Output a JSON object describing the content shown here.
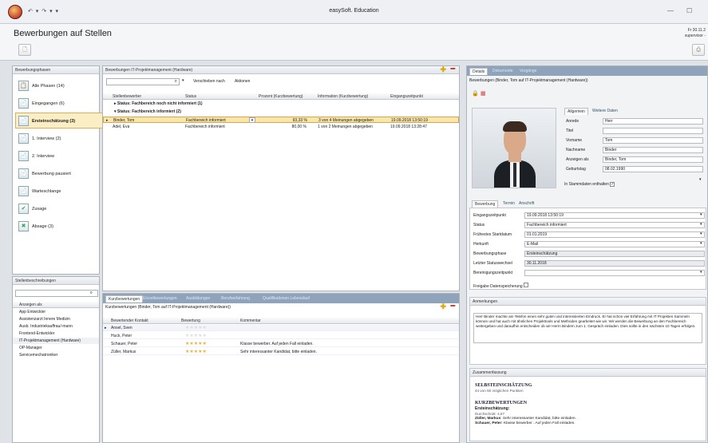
{
  "window": {
    "title": "easySoft. Education",
    "qat": "↶ ▾ ↷ ▾ ▾",
    "minimize": "—",
    "maximize": "☐"
  },
  "header": {
    "title": "Bewerbungen auf Stellen",
    "date": "Fr 30.11.2",
    "user": "supervisor -"
  },
  "phases": {
    "title": "Bewerbungsphasen",
    "items": [
      {
        "label": "Alle Phasen (14)",
        "icon": "📋"
      },
      {
        "label": "Eingegangen (6)",
        "icon": "📄"
      },
      {
        "label": "Ersteinschätzung (3)",
        "icon": "📄"
      },
      {
        "label": "1. Interview (2)",
        "icon": "📄"
      },
      {
        "label": "2. Interview",
        "icon": "📄"
      },
      {
        "label": "Bewerbung pausiert",
        "icon": "📄"
      },
      {
        "label": "Warteschlange",
        "icon": "📄"
      },
      {
        "label": "Zusage",
        "icon": "✔"
      },
      {
        "label": "Absage (3)",
        "icon": "✖"
      }
    ]
  },
  "jobs": {
    "title": "Stellenbeschreibungen",
    "header": "Anzeigen als",
    "items": [
      "App Entwickler",
      "Assistenzarzt Innere Medizin",
      "Ausb. Industriekauffrau/-mann",
      "Frontend-Entwickler",
      "IT-Projektmanagement (Hardware)",
      "OP-Manager",
      "Servicemechatroniker"
    ]
  },
  "applications": {
    "title": "Bewerbungen IT-Projektmanagement (Hardware)",
    "move_label": "Verschieben nach",
    "actions_label": "Aktionen",
    "columns": [
      "Stellenbewerber",
      "Status",
      "Prozent (Kurzbewertung)",
      "Information (Kurzbewertung)",
      "Eingangszeitpunkt"
    ],
    "group1": "Status: Fachbereich noch nicht informiert (1)",
    "group2": "Status: Fachbereich informiert (2)",
    "rows": [
      {
        "name": "Binder, Tom",
        "status": "Fachbereich informiert",
        "percent": "93,33 %",
        "info": "3 von 4 Meinungen abgegeben",
        "date": "19.09.2018 13:50:19"
      },
      {
        "name": "Adel, Eva",
        "status": "Fachbereich informiert",
        "percent": "80,00 %",
        "info": "1 von 2 Meinungen abgegeben",
        "date": "19.09.2018 13:28:47"
      }
    ]
  },
  "reviews": {
    "tabs": [
      "Kurzbewertungen",
      "Einzelbewertungen",
      "Ausbildungen",
      "Berufserfahrung",
      "Qualifikationen Lebenslauf"
    ],
    "title": "Kurzbewertungen (Binder, Tom auf IT-Projektmanagement (Hardware))",
    "columns": [
      "Bewertender Kontakt",
      "Bewertung",
      "Kommentar"
    ],
    "rows": [
      {
        "name": "Ansel, Sven",
        "stars": 0,
        "comment": ""
      },
      {
        "name": "Huck, Peter",
        "stars": 0,
        "comment": ""
      },
      {
        "name": "Schauer, Peter",
        "stars": 5,
        "comment": "Klasse bewerber. Auf jeden Fall einladen."
      },
      {
        "name": "Züller, Markus",
        "stars": 5,
        "comment": "Sehr interessanter Kandidat, bitte einladen."
      }
    ]
  },
  "detail": {
    "tabs": [
      "Details",
      "Dokumente",
      "Vorgänge"
    ],
    "title": "Bewerbungen (Binder, Tom auf IT-Projektmanagement (Hardware))",
    "person_tabs": [
      "Allgemein",
      "Weitere Daten"
    ],
    "fields": [
      {
        "label": "Anrede",
        "value": "Herr"
      },
      {
        "label": "Titel",
        "value": ""
      },
      {
        "label": "Vorname",
        "value": "Tom"
      },
      {
        "label": "Nachname",
        "value": "Binder"
      },
      {
        "label": "Anzeigen als",
        "value": "Binder, Tom"
      },
      {
        "label": "Geburtstag",
        "value": "08.02.1990"
      }
    ],
    "stammdaten": "In Stammdaten enthalten",
    "app_tabs": [
      "Bewerbung",
      "Termin",
      "Anschrift"
    ],
    "app_fields": [
      {
        "label": "Eingangszeitpunkt",
        "value": "19.09.2018 13:50:19"
      },
      {
        "label": "Status",
        "value": "Fachbereich informiert"
      },
      {
        "label": "Frühestes Startdatum",
        "value": "01.01.2019"
      },
      {
        "label": "Herkunft",
        "value": "E-Mail"
      },
      {
        "label": "Bewerbungsphase",
        "value": "Ersteinschätzung"
      },
      {
        "label": "Letzter Statuswechsel",
        "value": "30.11.2018"
      },
      {
        "label": "Bereinigungszeitpunkt",
        "value": ""
      }
    ],
    "release": "Freigabe Datenspeicherung",
    "notes_title": "Anmerkungen",
    "notes": "Herr Binder machte am Telefon einen sehr guten und interessierten Eindruck. Er hat schon viel Erfahrung mit IT Projekten Sammeln können und hat auch mit ähnlichen Projekttools und Methoden gearbeitet wie wir. Wir werden die Bewerbung an den Fachbereich weitergeben und daraufhin entscheiden ob wir Herrn Bindern zum 1. Gespräch einladen. Dies sollte in den nächsten 10 Tagen erfolgen.",
    "summary_title": "Zusammenfassung",
    "self_head": "SELBSTEINSCHÄTZUNG",
    "self_sub": "44 von 50 möglichen Punkten",
    "short_head": "KURZBEWERTUNGEN",
    "short_sub": "Ersteinschätzung:",
    "avg": "Durchschnitt: 4,67",
    "s1name": "Züller, Markus",
    "s1": ": Sehr interessanter Kandidat, bitte einladen.",
    "s2name": "Schauer, Peter",
    "s2": ": Klasse bewerber . Auf jeden Fall einladen."
  }
}
